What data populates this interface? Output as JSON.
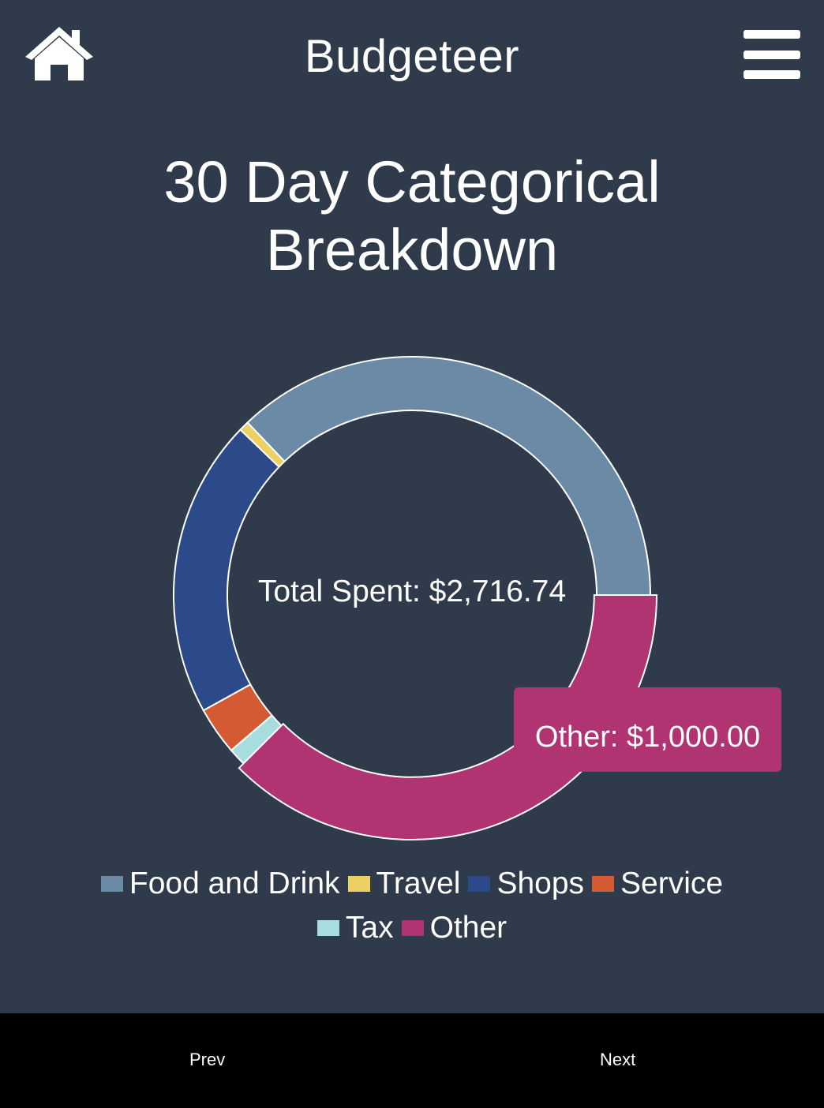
{
  "header": {
    "title": "Budgeteer",
    "home_icon": "home-icon",
    "menu_icon": "hamburger-menu-icon"
  },
  "page_title": "30 Day Categorical Breakdown",
  "center_label": "Total Spent: $2,716.74",
  "tooltip": "Other: $1,000.00",
  "colors": {
    "background": "#2f3a4a",
    "footer": "#000000",
    "tooltip": "#b03372"
  },
  "chart_data": {
    "type": "pie",
    "variant": "doughnut",
    "title": "30 Day Categorical Breakdown",
    "total_label": "Total Spent: $2,716.74",
    "categories": [
      "Food and Drink",
      "Travel",
      "Shops",
      "Service",
      "Tax",
      "Other"
    ],
    "values": [
      990.0,
      18.0,
      540.0,
      86.74,
      32.0,
      1000.0
    ],
    "colors": [
      "#6a8aa6",
      "#ecd063",
      "#2c4a8a",
      "#d45a34",
      "#a8dde0",
      "#b03372"
    ],
    "legend": "bottom",
    "tooltip": {
      "category": "Other",
      "label": "Other: $1,000.00"
    }
  },
  "legend": {
    "row1": [
      {
        "label": "Food and Drink",
        "color": "#6a8aa6"
      },
      {
        "label": "Travel",
        "color": "#ecd063"
      },
      {
        "label": "Shops",
        "color": "#2c4a8a"
      },
      {
        "label": "Service",
        "color": "#d45a34"
      }
    ],
    "row2": [
      {
        "label": "Tax",
        "color": "#a8dde0"
      },
      {
        "label": "Other",
        "color": "#b03372"
      }
    ]
  },
  "footer": {
    "prev_label": "Prev",
    "next_label": "Next"
  }
}
